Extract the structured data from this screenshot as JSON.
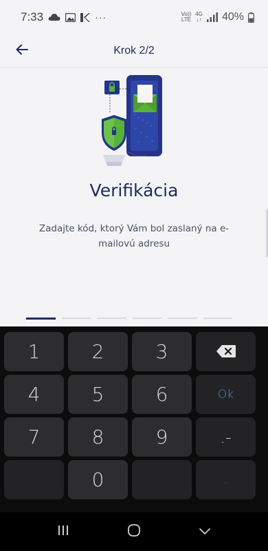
{
  "status_bar": {
    "time": "7:33",
    "more": "···",
    "net_top": "Vo))",
    "net_bottom": "LTE",
    "net2_top": "4G",
    "battery": "40%",
    "icons": [
      "cloud-icon",
      "image-icon",
      "k-app-icon",
      "signal-icon",
      "battery-icon"
    ]
  },
  "app_bar": {
    "title": "Krok 2/2",
    "back_icon": "arrow-left-icon"
  },
  "main": {
    "heading": "Verifikácia",
    "instruction": "Zadajte kód, ktorý Vám bol zaslaný na e-mailovú adresu",
    "illustration_icon": "phone-email-shield-illustration"
  },
  "code_input": {
    "length": 6,
    "active_index": 0
  },
  "keyboard": {
    "keys": [
      [
        "1",
        "2",
        "3",
        "⌫"
      ],
      [
        "4",
        "5",
        "6",
        "Ok"
      ],
      [
        "7",
        "8",
        "9",
        ".-"
      ],
      [
        "",
        "0",
        "",
        ","
      ]
    ]
  },
  "nav_bar": {
    "recents_icon": "recents-icon",
    "home_icon": "home-icon",
    "back_icon": "nav-back-chevron-icon"
  },
  "colors": {
    "primary": "#1f2a5c",
    "accent_green": "#58b23a",
    "ok_blue": "#3d8fe0",
    "keyboard_bg": "#0c0c0d",
    "key_bg": "#2d2d2f"
  }
}
